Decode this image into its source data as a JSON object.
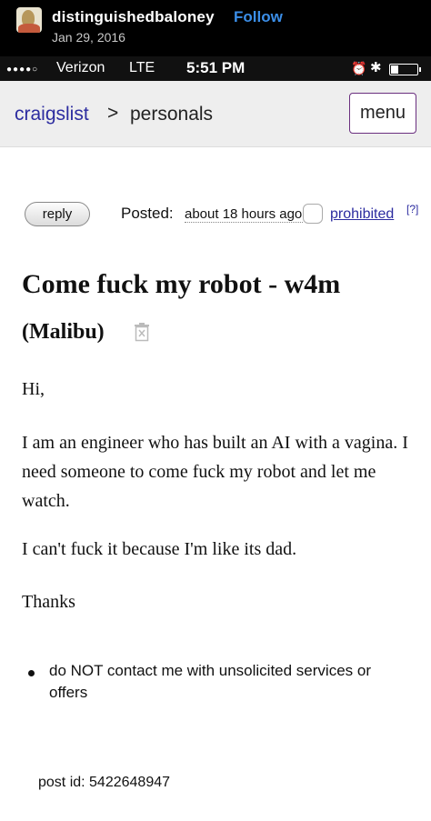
{
  "ig": {
    "username": "distinguishedbaloney",
    "follow_label": "Follow",
    "date": "Jan 29, 2016"
  },
  "status_bar": {
    "signal": "●●●●○",
    "carrier": "Verizon",
    "network": "LTE",
    "time": "5:51 PM",
    "alarm": "⏰",
    "bluetooth": "✱"
  },
  "nav": {
    "home": "craigslist",
    "separator": ">",
    "section": "personals",
    "menu_label": "menu"
  },
  "watermark": "craigslist",
  "post": {
    "reply_label": "reply",
    "posted_label": "Posted:",
    "posted_value": "about 18 hours ago",
    "prohibited_label": "prohibited",
    "help_label": "[?]",
    "title": "Come fuck my robot - w4m",
    "location": "(Malibu)",
    "greeting": "Hi,",
    "paragraph1": "I am an engineer who has built an AI with a vagina. I need someone to come fuck my robot and let me watch.",
    "paragraph2": "I can't fuck it because I'm like its dad.",
    "signoff": "Thanks",
    "notice": "do NOT contact me with unsolicited services or offers",
    "post_id": "post id: 5422648947"
  },
  "colors": {
    "link": "#2c2ca0",
    "follow": "#3b8ee8",
    "menu_border": "#6a2f7f"
  }
}
